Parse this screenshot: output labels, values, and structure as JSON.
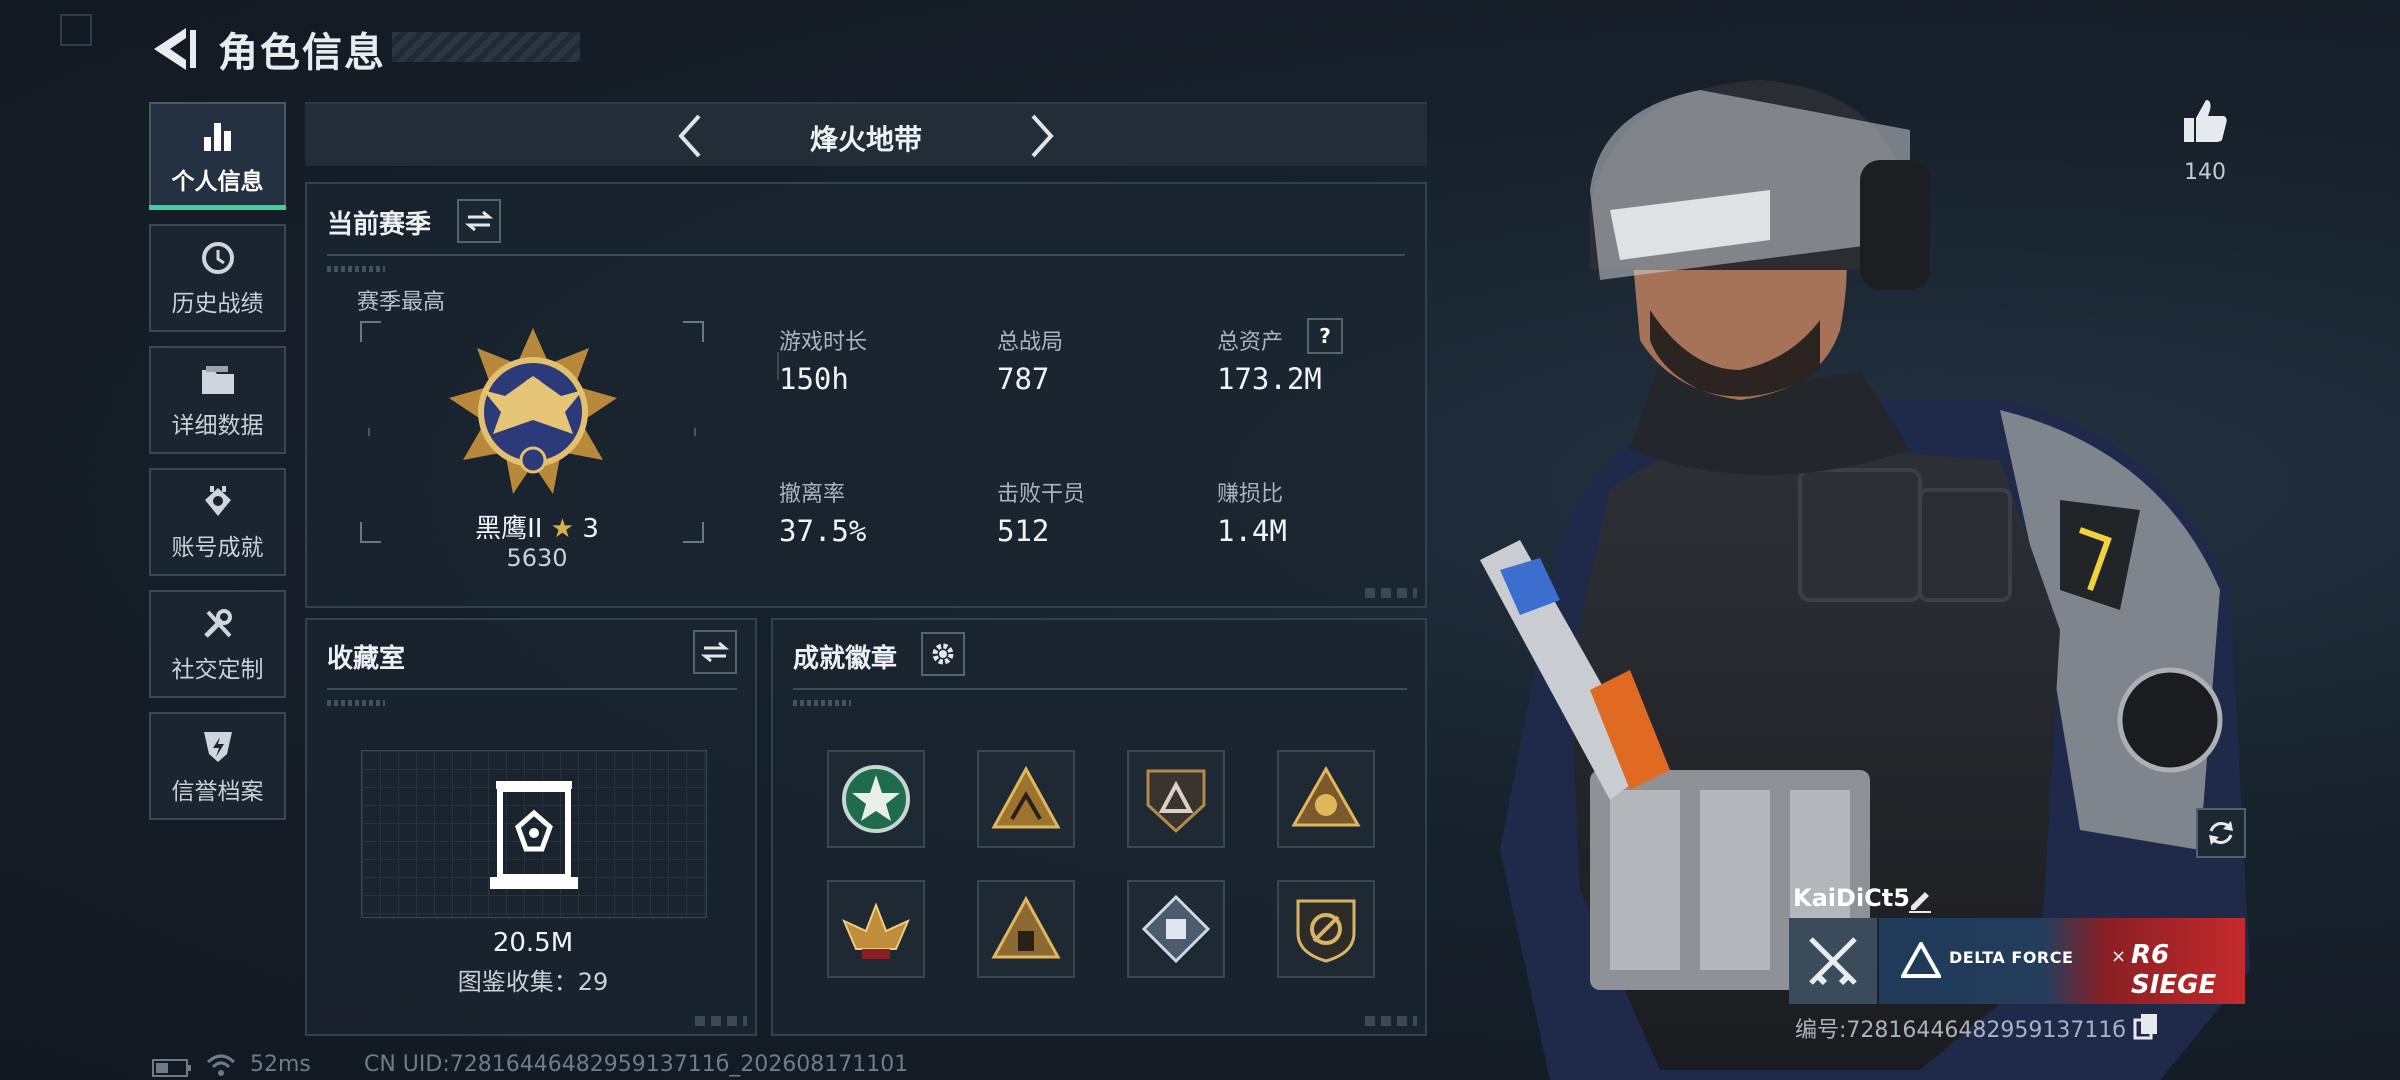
{
  "header": {
    "title": "角色信息"
  },
  "sidebar": {
    "items": [
      {
        "label": "个人信息",
        "icon": "bar-chart-icon",
        "active": true
      },
      {
        "label": "历史战绩",
        "icon": "history-clock-icon"
      },
      {
        "label": "详细数据",
        "icon": "folder-icon"
      },
      {
        "label": "账号成就",
        "icon": "achievement-medal-icon"
      },
      {
        "label": "社交定制",
        "icon": "wrench-screwdriver-icon"
      },
      {
        "label": "信誉档案",
        "icon": "reputation-shield-icon"
      }
    ]
  },
  "mode": {
    "title": "烽火地带"
  },
  "season": {
    "title": "当前赛季",
    "best_label": "赛季最高",
    "rank_name": "黑鹰II",
    "rank_stars": "3",
    "rank_points": "5630",
    "stats": [
      {
        "label": "游戏时长",
        "value": "150h"
      },
      {
        "label": "总战局",
        "value": "787"
      },
      {
        "label": "总资产",
        "value": "173.2M"
      },
      {
        "label": "撤离率",
        "value": "37.5%"
      },
      {
        "label": "击败干员",
        "value": "512"
      },
      {
        "label": "赚损比",
        "value": "1.4M"
      }
    ],
    "help_icon": "?"
  },
  "collection": {
    "title": "收藏室",
    "value": "20.5M",
    "count_label": "图鉴收集：29"
  },
  "badges": {
    "title": "成就徽章",
    "items": [
      "green-star-badge-icon",
      "gold-triangle-badge-icon",
      "dark-shield-badge-icon",
      "gold-triangle-emblem-icon",
      "gold-eagle-badge-icon",
      "gold-tent-badge-icon",
      "silver-diamond-badge-icon",
      "gold-round-shield-icon"
    ]
  },
  "character": {
    "likes": "140",
    "player_name": "KaiDiCt5",
    "card_left_text": "DELTA FORCE",
    "card_x": "×",
    "card_right_text": "R6 SIEGE",
    "player_id": "编号:7281644648295913711б"
  },
  "status_bar": {
    "ping": "52ms",
    "uid": "CN UID:7281644648295913711б_202608171101"
  },
  "colors": {
    "accent": "#35d49b",
    "panel_border": "#33414e",
    "gold": "#c9a24a"
  }
}
